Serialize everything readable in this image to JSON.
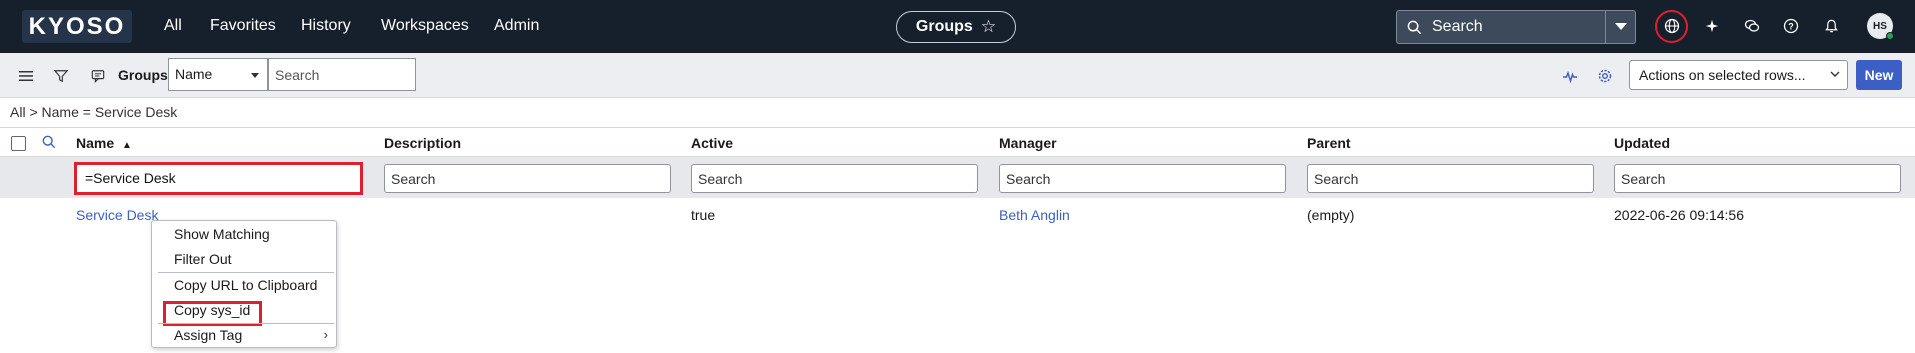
{
  "nav": {
    "logo": "KYOSO",
    "links": [
      "All",
      "Favorites",
      "History",
      "Workspaces",
      "Admin"
    ],
    "context_title": "Groups",
    "search_label": "Search",
    "avatar_initials": "HS"
  },
  "toolbar": {
    "title": "Groups",
    "field_select": "Name",
    "search_placeholder": "Search",
    "actions_select": "Actions on selected rows...",
    "new_label": "New"
  },
  "breadcrumb": "All > Name = Service Desk",
  "columns": [
    "Name",
    "Description",
    "Active",
    "Manager",
    "Parent",
    "Updated"
  ],
  "filters": {
    "name_value": "=Service Desk",
    "placeholder": "Search"
  },
  "rows": [
    {
      "name": "Service Desk",
      "description": "",
      "active": "true",
      "manager": "Beth Anglin",
      "parent": "(empty)",
      "updated": "2022-06-26 09:14:56"
    }
  ],
  "context_menu": {
    "items": [
      "Show Matching",
      "Filter Out",
      "Copy URL to Clipboard",
      "Copy sys_id",
      "Assign Tag"
    ]
  },
  "colors": {
    "nav_bg": "#16202c",
    "accent": "#3b5fc5",
    "highlight": "#e01f2e"
  }
}
